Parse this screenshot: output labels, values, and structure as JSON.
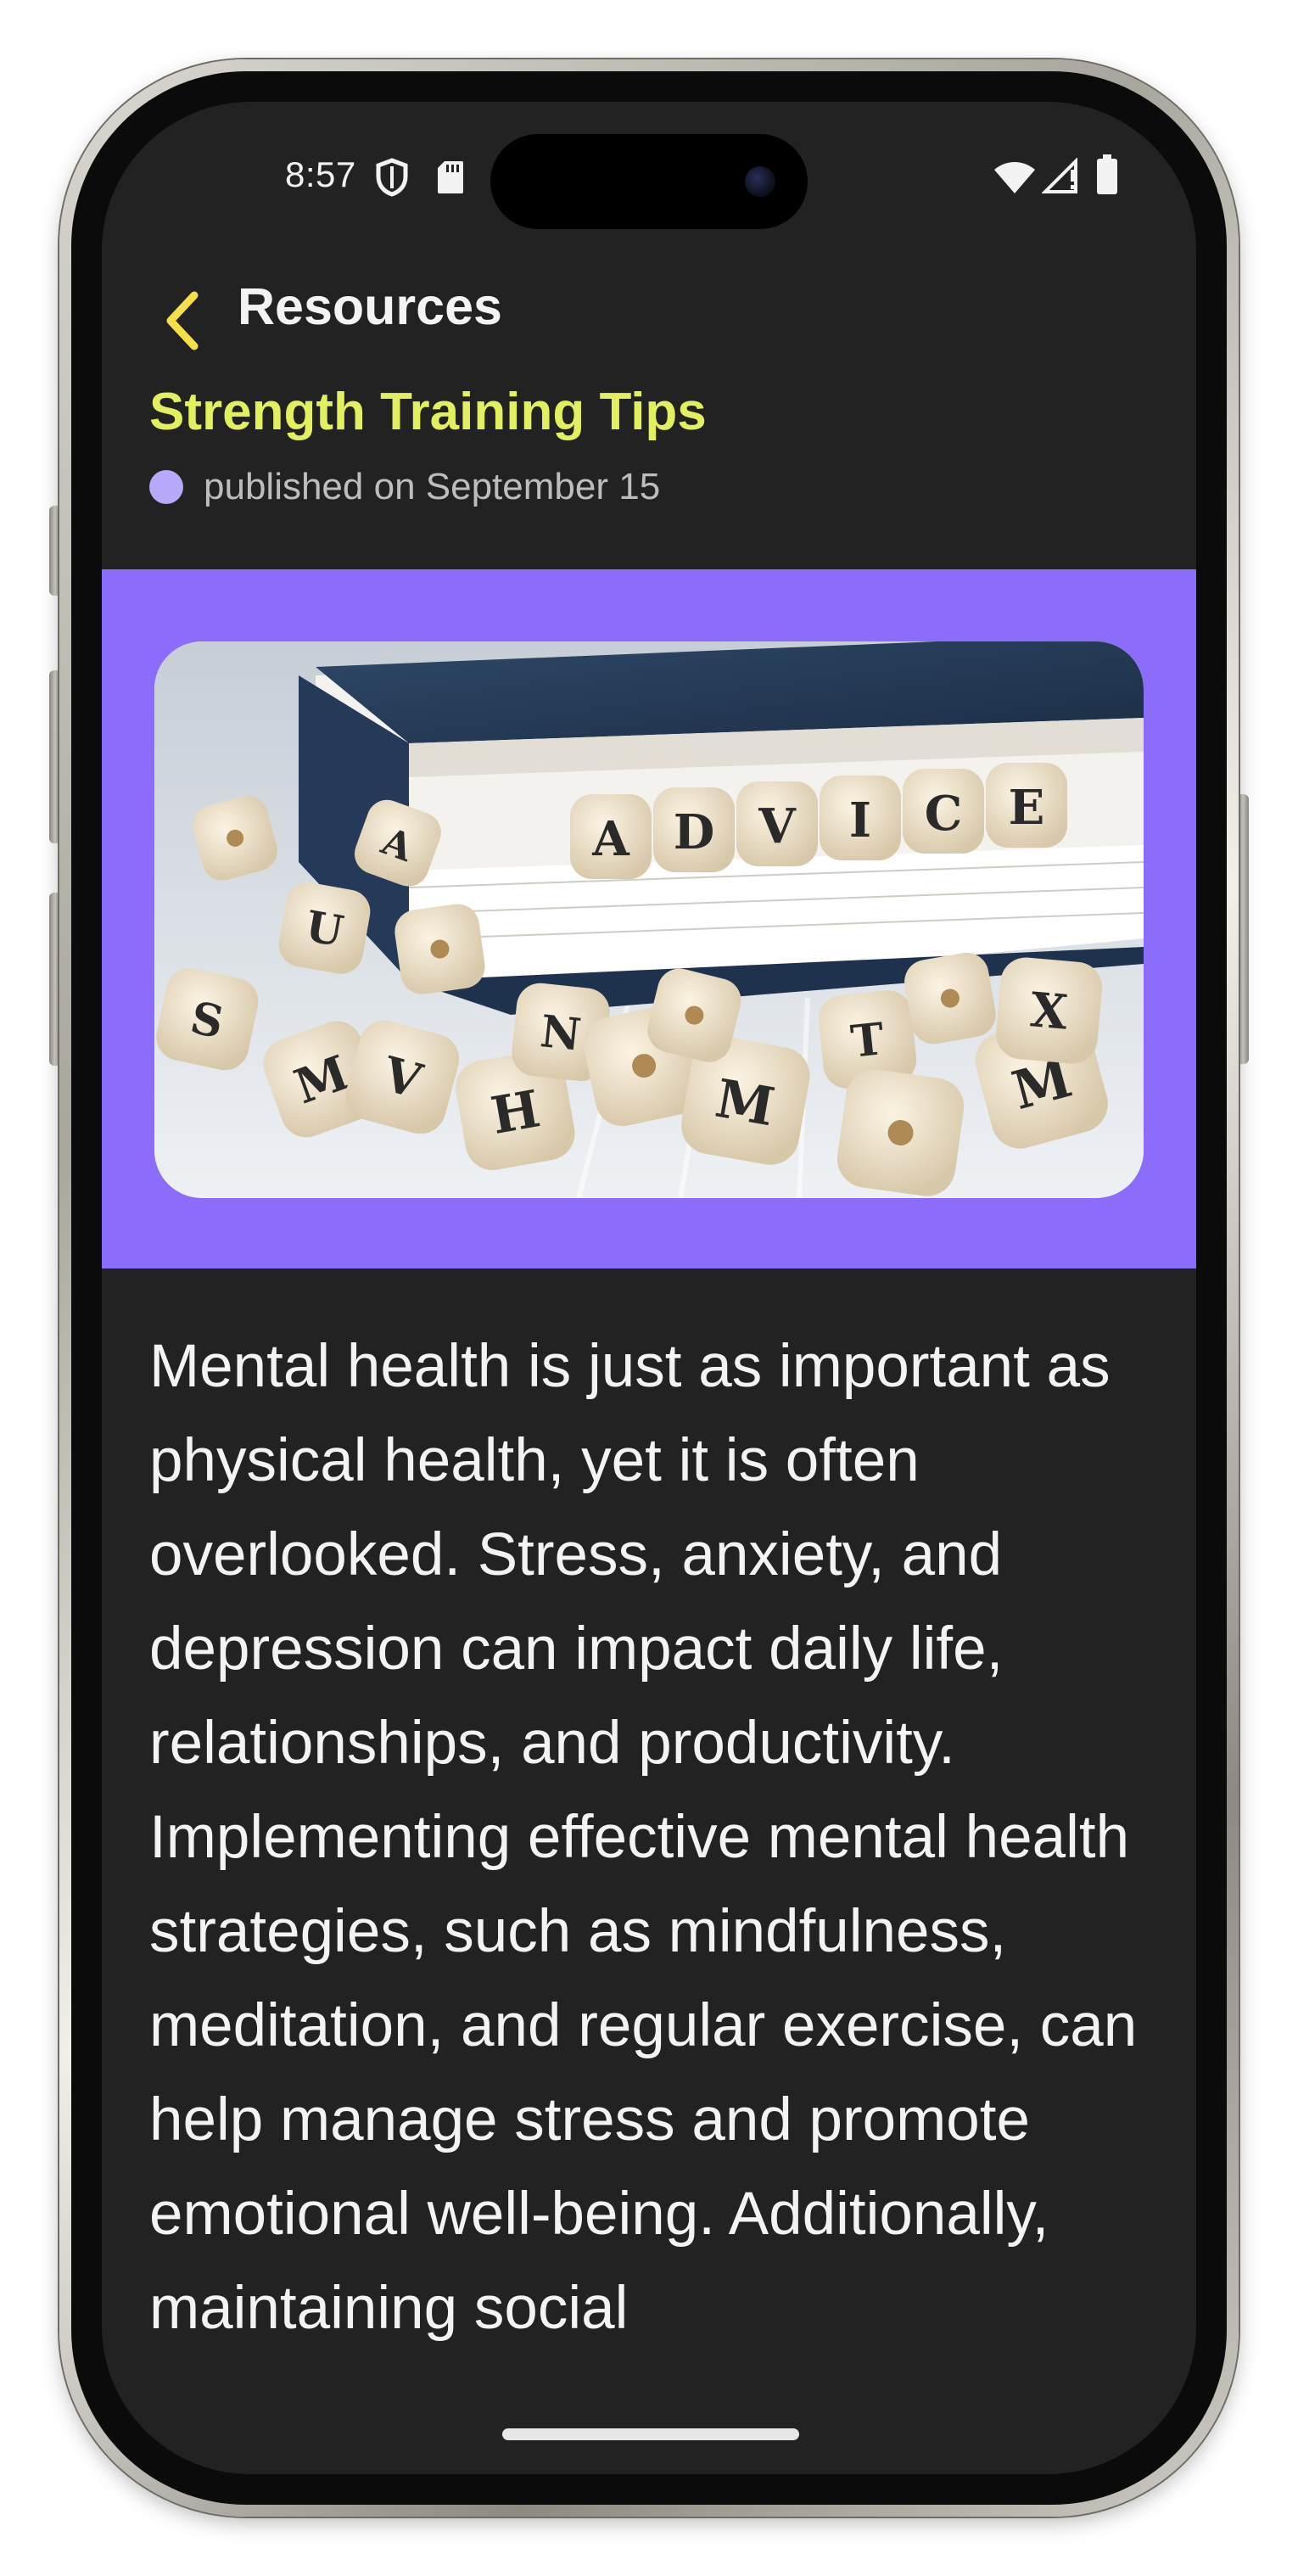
{
  "status_bar": {
    "time": "8:57",
    "left_icons": [
      "shield-icon",
      "sd-card-icon"
    ],
    "right_icons": [
      "wifi-icon",
      "cell-signal-icon",
      "battery-icon"
    ]
  },
  "header": {
    "back_icon": "chevron-left-icon",
    "title": "Resources"
  },
  "article": {
    "title": "Strength Training Tips",
    "published": "published on September 15",
    "hero_image_text": "ADVICE",
    "body": "Mental health is just as important as physical health, yet it is often overlooked. Stress, anxiety, and depression can impact daily life, relationships, and productivity. Implementing effective mental health strategies, such as mindfulness, meditation, and regular exercise, can help manage stress and promote emotional well-being. Additionally, maintaining social"
  },
  "colors": {
    "screen_bg": "#222222",
    "accent_yellow": "#e2ef5e",
    "hero_band": "#8b6cfb",
    "dot": "#b7a8fa",
    "back_icon": "#f5e04a"
  }
}
